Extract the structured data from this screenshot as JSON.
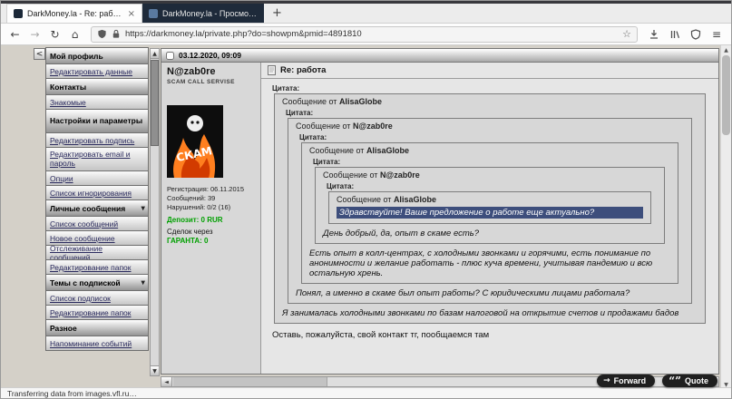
{
  "glyphs": {
    "close": "×",
    "plus": "+",
    "back": "←",
    "forward": "→",
    "reload": "↻",
    "home": "⌂",
    "star": "☆",
    "menu": "≡",
    "collapse": "<",
    "scroll_up": "▲",
    "scroll_down": "▼",
    "scroll_left": "◄",
    "scroll_right": "►",
    "dropdown": "▼",
    "forward_icon": "→",
    "quote_icon": "“”"
  },
  "browser": {
    "tabs": [
      {
        "label": "DarkMoney.la - Re: работа",
        "active": true
      },
      {
        "label": "DarkMoney.la - Просмотр пр…",
        "active": false
      }
    ],
    "url": "https://darkmoney.la/private.php?do=showpm&pmid=4891810",
    "status_text": "Transferring data from images.vfl.ru…"
  },
  "sidebar": {
    "items": [
      {
        "label": "Мой профиль",
        "type": "header"
      },
      {
        "label": "Редактировать данные",
        "type": "link"
      },
      {
        "label": "Контакты",
        "type": "header"
      },
      {
        "label": "Знакомые",
        "type": "link"
      },
      {
        "label": "Настройки и параметры",
        "type": "header"
      },
      {
        "label": "Редактировать подпись",
        "type": "link"
      },
      {
        "label": "Редактировать email и пароль",
        "type": "link"
      },
      {
        "label": "Опции",
        "type": "link"
      },
      {
        "label": "Список игнорирования",
        "type": "link"
      },
      {
        "label": "Личные сообщения",
        "type": "header"
      },
      {
        "label": "Список сообщений",
        "type": "link"
      },
      {
        "label": "Новое сообщение",
        "type": "link"
      },
      {
        "label": "Отслеживание сообщений",
        "type": "link"
      },
      {
        "label": "Редактирование папок",
        "type": "link"
      },
      {
        "label": "Темы с подпиской",
        "type": "header"
      },
      {
        "label": "Список подписок",
        "type": "link"
      },
      {
        "label": "Редактирование папок",
        "type": "link"
      },
      {
        "label": "Разное",
        "type": "header"
      },
      {
        "label": "Напоминание событий",
        "type": "link"
      }
    ]
  },
  "post": {
    "date": "03.12.2020, 09:09",
    "subject": "Re: работа",
    "quote_label": "Цитата:",
    "author": {
      "name": "N@zab0re",
      "title": "SCAM CALL SERVISE",
      "avatar_text": "СКАМ",
      "registered": "Регистрация: 06.11.2015",
      "messages": "Сообщений: 39",
      "violations": "Нарушений: 0/2 (16)",
      "deposit": "Депозит: 0 RUR",
      "deals_line1": "Сделок через",
      "deals_line2": "ГАРАНТА: 0"
    },
    "quotes": {
      "level1": {
        "prefix": "Сообщение от",
        "author": "AlisaGlobe",
        "text": "Я занималась холодными звонками по базам налоговой на открытие счетов и продажами бадов"
      },
      "level2": {
        "prefix": "Сообщение от",
        "author": "N@zab0re",
        "text": "Понял, а именно в скаме был опыт работы? С юридическими лицами работала?"
      },
      "level3": {
        "prefix": "Сообщение от",
        "author": "AlisaGlobe",
        "text": "Есть опыт в колл-центрах, с холодными звонками и горячими, есть понимание по анонимности и желание работать - плюс куча времени, учитывая пандемию и всю остальную хрень."
      },
      "level4": {
        "prefix": "Сообщение от",
        "author": "N@zab0re",
        "text": "День добрый, да, опыт в скаме есть?"
      },
      "level5": {
        "prefix": "Сообщение от",
        "author": "AlisaGlobe",
        "text": "Здравствуйте! Ваше предложение о работе еще актуально?"
      }
    },
    "body": "Оставь, пожалуйста, свой контакт тг, пообщаемся там",
    "buttons": {
      "forward": "Forward",
      "quote": "Quote"
    }
  }
}
